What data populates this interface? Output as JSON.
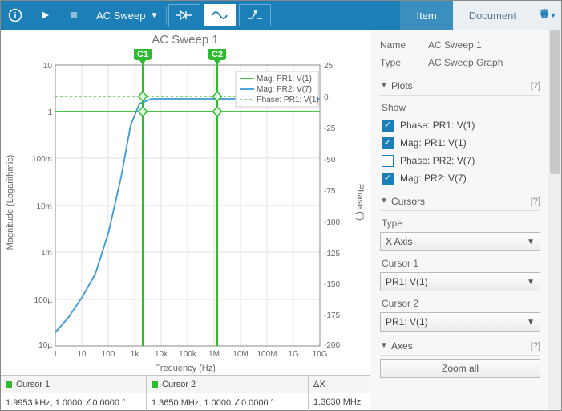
{
  "toolbar": {
    "mode_label": "AC Sweep",
    "tab_item": "Item",
    "tab_document": "Document"
  },
  "panel": {
    "name_label": "Name",
    "name_value": "AC Sweep 1",
    "type_label": "Type",
    "type_value": "AC Sweep Graph",
    "plots": {
      "title": "Plots",
      "help": "[?]",
      "show_label": "Show",
      "items": [
        {
          "label": "Phase: PR1: V(1)",
          "checked": true
        },
        {
          "label": "Mag: PR1: V(1)",
          "checked": true
        },
        {
          "label": "Phase: PR2: V(7)",
          "checked": false
        },
        {
          "label": "Mag: PR2: V(7)",
          "checked": true
        }
      ]
    },
    "cursors": {
      "title": "Cursors",
      "help": "[?]",
      "type_label": "Type",
      "type_value": "X Axis",
      "c1_label": "Cursor 1",
      "c1_value": "PR1: V(1)",
      "c2_label": "Cursor 2",
      "c2_value": "PR1: V(1)"
    },
    "axes": {
      "title": "Axes",
      "help": "[?]",
      "zoom_all": "Zoom all"
    }
  },
  "cursor_table": {
    "c1_header": "Cursor 1",
    "c2_header": "Cursor 2",
    "dx_header": "ΔX",
    "c1_value": "1.9953 kHz, 1.0000 ∠0.0000 °",
    "c2_value": "1.3650 MHz, 1.0000 ∠0.0000 °",
    "dx_value": "1.3630 MHz"
  },
  "chart_data": {
    "type": "line",
    "title": "AC Sweep 1",
    "xlabel": "Frequency (Hz)",
    "ylabel_left": "Magnitude (Logarithmic)",
    "ylabel_right": "Phase (°)",
    "x_scale": "log",
    "x_ticks": [
      "1",
      "10",
      "100",
      "1k",
      "10k",
      "100k",
      "1M",
      "10M",
      "100M",
      "1G",
      "10G"
    ],
    "y_left_scale": "log",
    "y_left_ticks": [
      "10µ",
      "100µ",
      "1m",
      "10m",
      "100m",
      "1",
      "10"
    ],
    "y_right_ticks": [
      25,
      0,
      -25,
      -50,
      -75,
      -100,
      -125,
      -150,
      -175,
      -200
    ],
    "legend": [
      "Mag: PR1: V(1)",
      "Mag: PR2: V(7)",
      "Phase: PR1: V(1)"
    ],
    "series": [
      {
        "name": "Mag: PR1: V(1)",
        "color": "#2fbb2f",
        "style": "solid",
        "values_y": [
          1,
          1,
          1,
          1,
          1,
          1,
          1,
          1,
          1,
          1,
          1
        ],
        "note": "constant 1 across all frequencies"
      },
      {
        "name": "Mag: PR2: V(7)",
        "color": "#3a99d8",
        "style": "solid",
        "x": [
          1,
          3,
          10,
          30,
          100,
          300,
          1000,
          3000,
          10000
        ],
        "y": [
          2e-05,
          5e-05,
          0.00015,
          0.0005,
          0.01,
          0.25,
          1.5,
          2,
          2
        ]
      },
      {
        "name": "Phase: PR1: V(1)",
        "color": "#2fbb2f",
        "style": "dashed",
        "values_y": [
          0,
          0,
          0,
          0,
          0,
          0,
          0,
          0,
          0,
          0,
          0
        ],
        "note": "constant 0° across all frequencies"
      }
    ],
    "cursors": [
      {
        "name": "C1",
        "x": "1.9953 kHz",
        "mag": "1.0000",
        "phase": "0.0000 °"
      },
      {
        "name": "C2",
        "x": "1.3650 MHz",
        "mag": "1.0000",
        "phase": "0.0000 °"
      }
    ],
    "dx": "1.3630 MHz"
  }
}
